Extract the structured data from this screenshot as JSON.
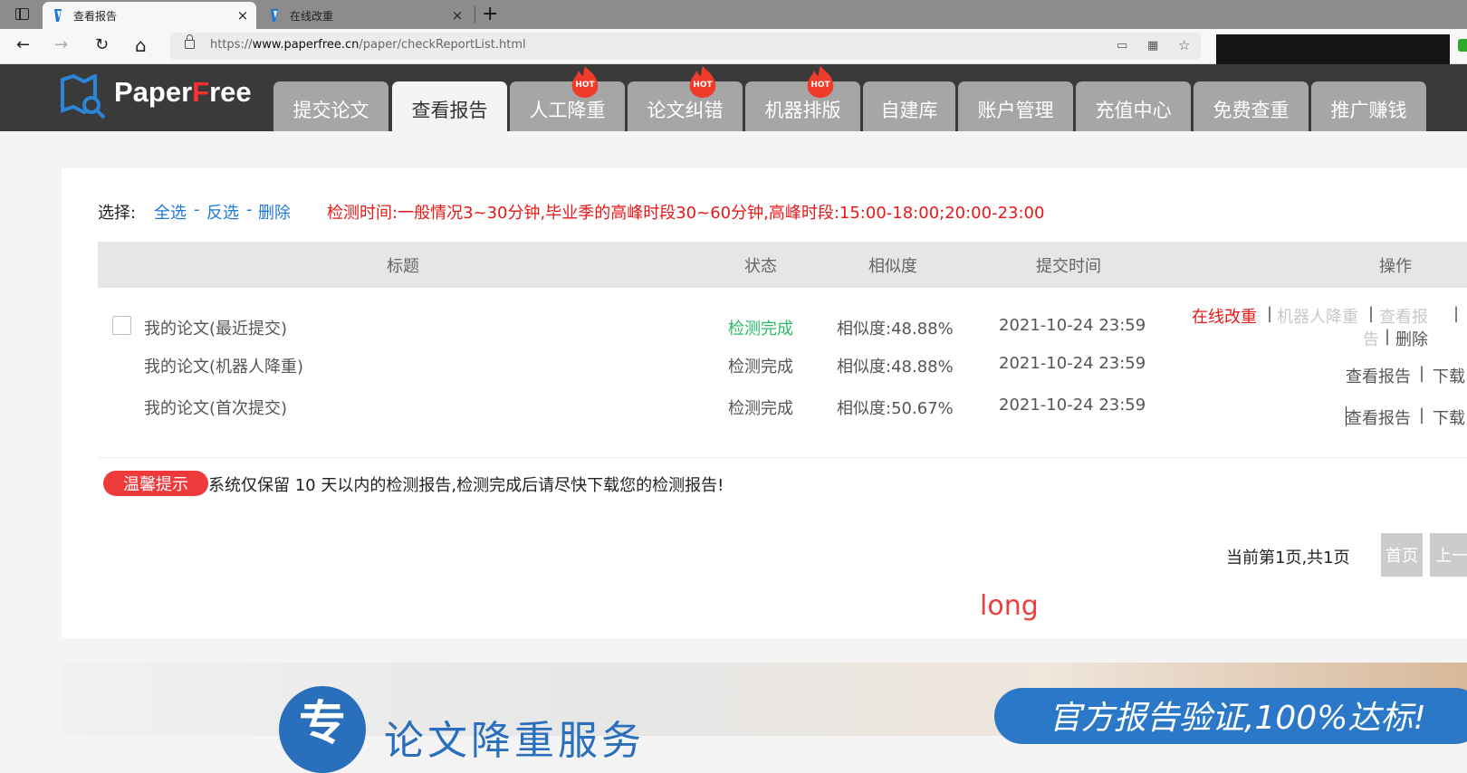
{
  "browser": {
    "tabs": [
      {
        "title": "查看报告",
        "active": true
      },
      {
        "title": "在线改重",
        "active": false
      }
    ],
    "new_tab_symbol": "+",
    "close_symbol": "×",
    "url": {
      "scheme": "https://",
      "host": "www.paperfree.cn",
      "path": "/paper/checkReportList.html"
    },
    "nav": {
      "back": "←",
      "forward": "→",
      "reload": "↻",
      "home": "⌂"
    },
    "icons": [
      "tabs-icon",
      "lock-icon",
      "cast-icon",
      "apps-icon",
      "favorite-add-icon"
    ]
  },
  "site": {
    "logo": {
      "part1": "Paper",
      "part2": "F",
      "part3": "ree"
    },
    "nav_tabs": [
      {
        "label": "提交论文",
        "hot": false
      },
      {
        "label": "查看报告",
        "hot": false,
        "active": true
      },
      {
        "label": "人工降重",
        "hot": true
      },
      {
        "label": "论文纠错",
        "hot": true
      },
      {
        "label": "机器排版",
        "hot": true
      },
      {
        "label": "自建库",
        "hot": false
      },
      {
        "label": "账户管理",
        "hot": false
      },
      {
        "label": "充值中心",
        "hot": false
      },
      {
        "label": "免费查重",
        "hot": false
      },
      {
        "label": "推广赚钱",
        "hot": false
      }
    ],
    "hot_badge": "HOT"
  },
  "report_list": {
    "select_label": "选择:",
    "select_all": "全选",
    "invert": "反选",
    "delete": "删除",
    "dash": "-",
    "notice": "检测时间:一般情况3~30分钟,毕业季的高峰时段30~60分钟,高峰时段:15:00-18:00;20:00-23:00",
    "columns": {
      "title": "标题",
      "status": "状态",
      "similarity": "相似度",
      "submit_time": "提交时间",
      "actions": "操作"
    },
    "rows": [
      {
        "title": "我的论文(最近提交)",
        "status": "检测完成",
        "similarity": "相似度:48.88%",
        "time": "2021-10-24 23:59"
      },
      {
        "title": "我的论文(机器人降重)",
        "status": "检测完成",
        "similarity": "相似度:48.88%",
        "time": "2021-10-24 23:59"
      },
      {
        "title": "我的论文(首次提交)",
        "status": "检测完成",
        "similarity": "相似度:50.67%",
        "time": "2021-10-24 23:59"
      }
    ],
    "row1_actions": {
      "online_edit": "在线改重",
      "robot_reduce": "机器人降重",
      "view_report_part1": "查看报",
      "view_report_part2": "告",
      "delete": "删除",
      "separator": "|"
    },
    "row_actions": {
      "view_report": "查看报告",
      "download_partial": "下载"
    },
    "tip_badge": "温馨提示",
    "tip_text": "系统仅保留 10 天以内的检测报告,检测完成后请尽快下载您的检测报告!",
    "pagination": {
      "info": "当前第1页,共1页",
      "first": "首页",
      "prev_partial": "上一"
    },
    "long_text": "long"
  },
  "banner": {
    "circle_char": "专",
    "service_text": "论文降重服务",
    "slogan": "官方报告验证,100%达标!"
  }
}
